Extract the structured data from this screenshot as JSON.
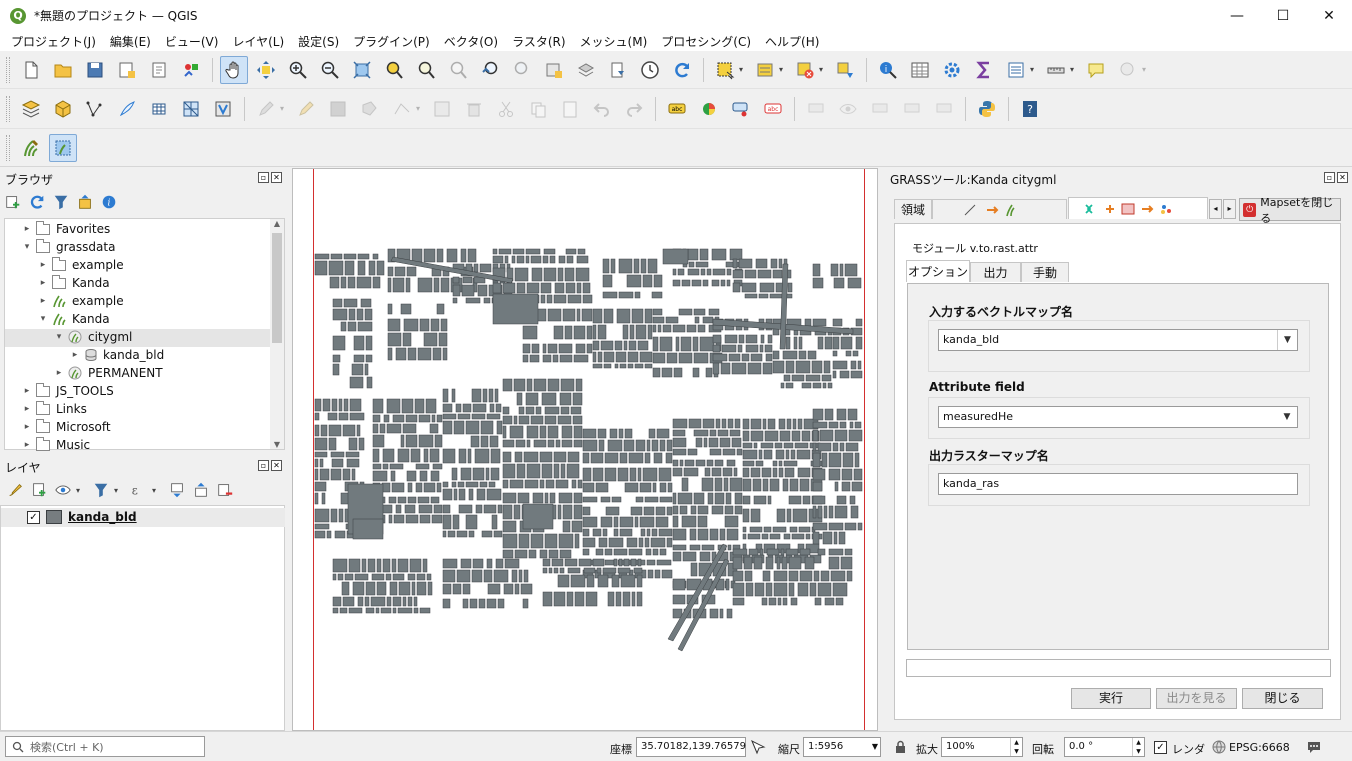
{
  "window": {
    "title": "*無題のプロジェクト — QGIS",
    "logo": "Q",
    "minimize": "—",
    "maximize": "☐",
    "close": "✕"
  },
  "menu": [
    "プロジェクト(J)",
    "編集(E)",
    "ビュー(V)",
    "レイヤ(L)",
    "設定(S)",
    "プラグイン(P)",
    "ベクタ(O)",
    "ラスタ(R)",
    "メッシュ(M)",
    "プロセシング(C)",
    "ヘルプ(H)"
  ],
  "browser": {
    "title": "ブラウザ",
    "items": [
      {
        "label": "Favorites",
        "level": 0,
        "expanded": false,
        "icon": "star-folder-icon"
      },
      {
        "label": "grassdata",
        "level": 0,
        "expanded": true,
        "icon": "folder-icon"
      },
      {
        "label": "example",
        "level": 1,
        "expanded": false,
        "icon": "folder-icon"
      },
      {
        "label": "Kanda",
        "level": 1,
        "expanded": false,
        "icon": "folder-icon"
      },
      {
        "label": "example",
        "level": 1,
        "expanded": false,
        "icon": "grass-location-icon"
      },
      {
        "label": "Kanda",
        "level": 1,
        "expanded": true,
        "icon": "grass-location-icon"
      },
      {
        "label": "citygml",
        "level": 2,
        "expanded": true,
        "icon": "grass-mapset-icon",
        "selected": true
      },
      {
        "label": "kanda_bld",
        "level": 3,
        "expanded": false,
        "icon": "vector-db-icon"
      },
      {
        "label": "PERMANENT",
        "level": 2,
        "expanded": false,
        "icon": "grass-mapset-icon"
      },
      {
        "label": "JS_TOOLS",
        "level": 0,
        "expanded": false,
        "icon": "folder-icon"
      },
      {
        "label": "Links",
        "level": 0,
        "expanded": false,
        "icon": "folder-icon"
      },
      {
        "label": "Microsoft",
        "level": 0,
        "expanded": false,
        "icon": "folder-icon"
      },
      {
        "label": "Music",
        "level": 0,
        "expanded": false,
        "icon": "folder-icon"
      }
    ]
  },
  "layers": {
    "title": "レイヤ",
    "items": [
      {
        "label": "kanda_bld",
        "checked": true,
        "color": "#777d80"
      }
    ]
  },
  "grass": {
    "title": "GRASSツール:Kanda citygml",
    "tab_region": "領域",
    "close_mapset": "Mapsetを閉じる",
    "module_label": "モジュール v.to.rast.attr",
    "tabs": [
      "オプション",
      "出力",
      "手動"
    ],
    "fields": [
      {
        "label": "入力するベクトルマップ名",
        "value": "kanda_bld",
        "type": "combo"
      },
      {
        "label": "Attribute field",
        "value": "measuredHe",
        "type": "combo"
      },
      {
        "label": "出力ラスターマップ名",
        "value": "kanda_ras",
        "type": "text"
      }
    ],
    "buttons": {
      "run": "実行",
      "view_output": "出力を見る",
      "close": "閉じる"
    }
  },
  "status": {
    "search_placeholder": "検索(Ctrl + K)",
    "coord_label": "座標",
    "coord_value": "35.70182,139.76579",
    "scale_label": "縮尺",
    "scale_value": "1:5956",
    "magnifier_label": "拡大",
    "magnifier_value": "100%",
    "rotation_label": "回転",
    "rotation_value": "0.0 °",
    "render_label": "レンダ",
    "crs": "EPSG:6668"
  },
  "colors": {
    "building_fill": "#717a7e",
    "building_stroke": "#3b3f42",
    "map_bg": "#ffffff",
    "extent_line": "#d32f2f",
    "qgis_green": "#589632"
  }
}
